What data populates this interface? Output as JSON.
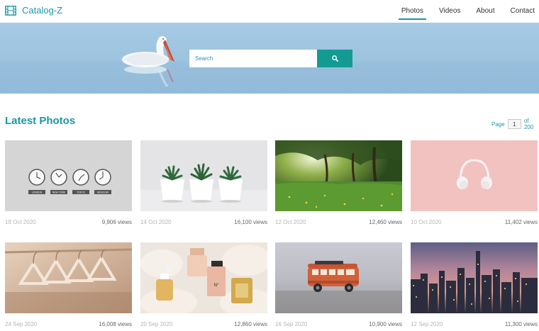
{
  "header": {
    "brand": "Catalog-Z",
    "nav": [
      "Photos",
      "Videos",
      "About",
      "Contact"
    ],
    "active_nav": "Photos"
  },
  "hero": {
    "search_placeholder": "Search",
    "search_icon": "search-icon"
  },
  "section": {
    "title": "Latest Photos",
    "page_label": "Page",
    "page_value": "1",
    "page_total": "of 200"
  },
  "photos": [
    {
      "date": "18 Oct 2020",
      "views": "9,906 views",
      "subject": "world clocks"
    },
    {
      "date": "14 Oct 2020",
      "views": "16,100 views",
      "subject": "potted plants"
    },
    {
      "date": "12 Oct 2020",
      "views": "12,460 views",
      "subject": "forest meadow"
    },
    {
      "date": "10 Oct 2020",
      "views": "11,402 views",
      "subject": "pink headphones"
    },
    {
      "date": "24 Sep 2020",
      "views": "16,008 views",
      "subject": "clothes hangers"
    },
    {
      "date": "20 Sep 2020",
      "views": "12,860 views",
      "subject": "perfume bottles"
    },
    {
      "date": "16 Sep 2020",
      "views": "10,900 views",
      "subject": "toy bus"
    },
    {
      "date": "12 Sep 2020",
      "views": "11,300 views",
      "subject": "city at dusk"
    }
  ],
  "clock_labels": [
    "LONDON",
    "NEW YORK",
    "TOKYO",
    "MOSCOW"
  ],
  "colors": {
    "accent": "#1a97a8",
    "search_button": "#139b93",
    "hero_sky": "#a6cae4"
  }
}
